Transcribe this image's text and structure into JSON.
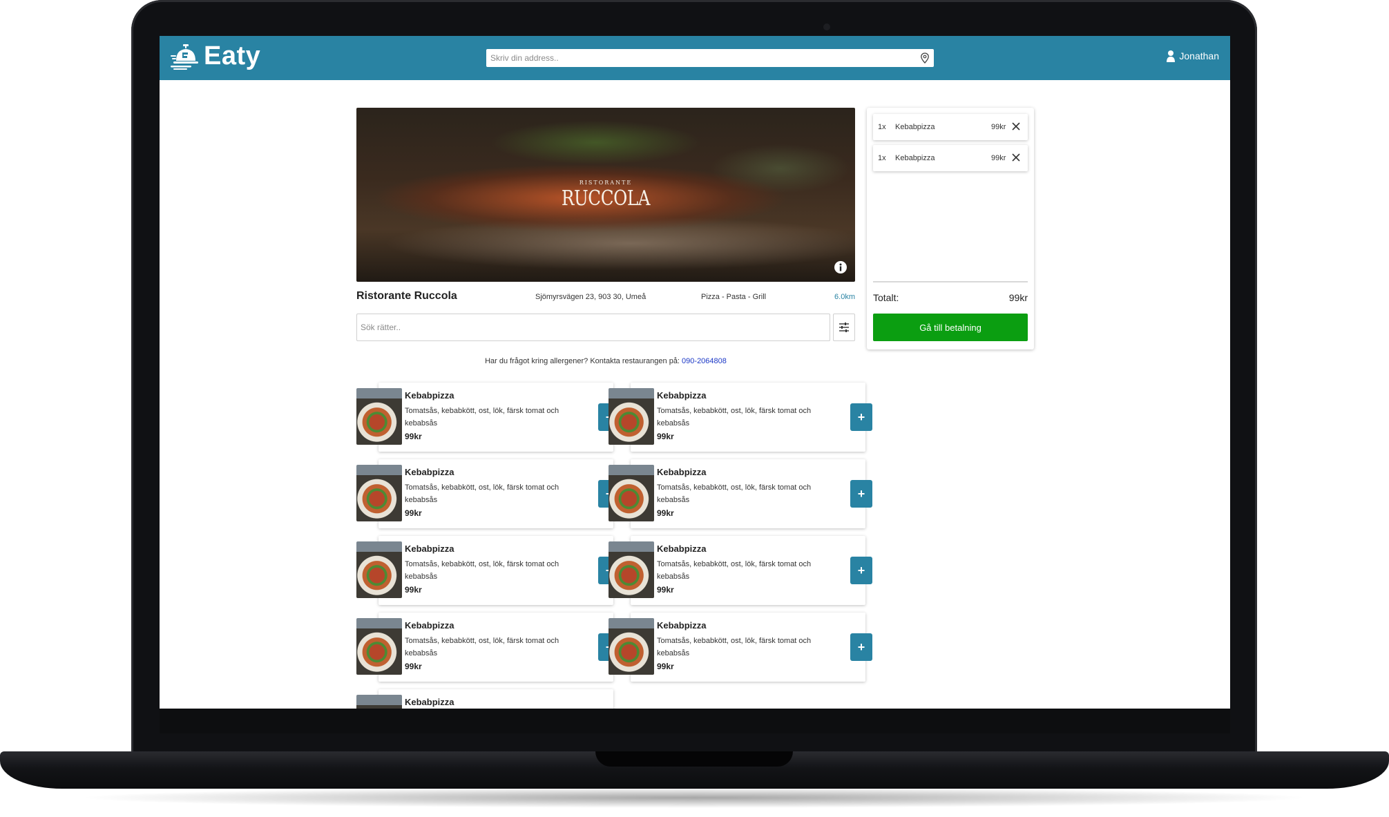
{
  "brand": {
    "name": "Eaty",
    "logo_icon": "food-cloche-delivery-icon"
  },
  "colors": {
    "primary": "#2983a3",
    "pay_button": "#0b9e11",
    "link": "#1a37c6"
  },
  "header": {
    "address_placeholder": "Skriv din address..",
    "user_name": "Jonathan"
  },
  "restaurant": {
    "banner_subtitle": "RISTORANTE",
    "banner_title": "RUCCOLA",
    "name": "Ristorante Ruccola",
    "address": "Sjömyrsvägen 23, 903 30, Umeå",
    "categories": "Pizza - Pasta - Grill",
    "distance": "6.0km"
  },
  "menu": {
    "search_placeholder": "Sök rätter..",
    "allergy_text": "Har du frågot kring allergener? Kontakta restaurangen på: ",
    "allergy_phone": "090-2064808",
    "items": [
      {
        "name": "Kebabpizza",
        "description": "Tomatsås, kebabkött, ost, lök, färsk tomat och kebabsås",
        "price": "99kr",
        "add_label": "+"
      },
      {
        "name": "Kebabpizza",
        "description": "Tomatsås, kebabkött, ost, lök, färsk tomat och kebabsås",
        "price": "99kr",
        "add_label": "+"
      },
      {
        "name": "Kebabpizza",
        "description": "Tomatsås, kebabkött, ost, lök, färsk tomat och kebabsås",
        "price": "99kr",
        "add_label": "+"
      },
      {
        "name": "Kebabpizza",
        "description": "Tomatsås, kebabkött, ost, lök, färsk tomat och kebabsås",
        "price": "99kr",
        "add_label": "+"
      },
      {
        "name": "Kebabpizza",
        "description": "Tomatsås, kebabkött, ost, lök, färsk tomat och kebabsås",
        "price": "99kr",
        "add_label": "+"
      },
      {
        "name": "Kebabpizza",
        "description": "Tomatsås, kebabkött, ost, lök, färsk tomat och kebabsås",
        "price": "99kr",
        "add_label": "+"
      },
      {
        "name": "Kebabpizza",
        "description": "Tomatsås, kebabkött, ost, lök, färsk tomat och kebabsås",
        "price": "99kr",
        "add_label": "+"
      },
      {
        "name": "Kebabpizza",
        "description": "Tomatsås, kebabkött, ost, lök, färsk tomat och kebabsås",
        "price": "99kr",
        "add_label": "+"
      },
      {
        "name": "Kebabpizza",
        "description": "",
        "price": "",
        "add_label": ""
      }
    ]
  },
  "cart": {
    "items": [
      {
        "qty": "1x",
        "name": "Kebabpizza",
        "price": "99kr"
      },
      {
        "qty": "1x",
        "name": "Kebabpizza",
        "price": "99kr"
      }
    ],
    "total_label": "Totalt:",
    "total_value": "99kr",
    "checkout_label": "Gå till betalning"
  }
}
